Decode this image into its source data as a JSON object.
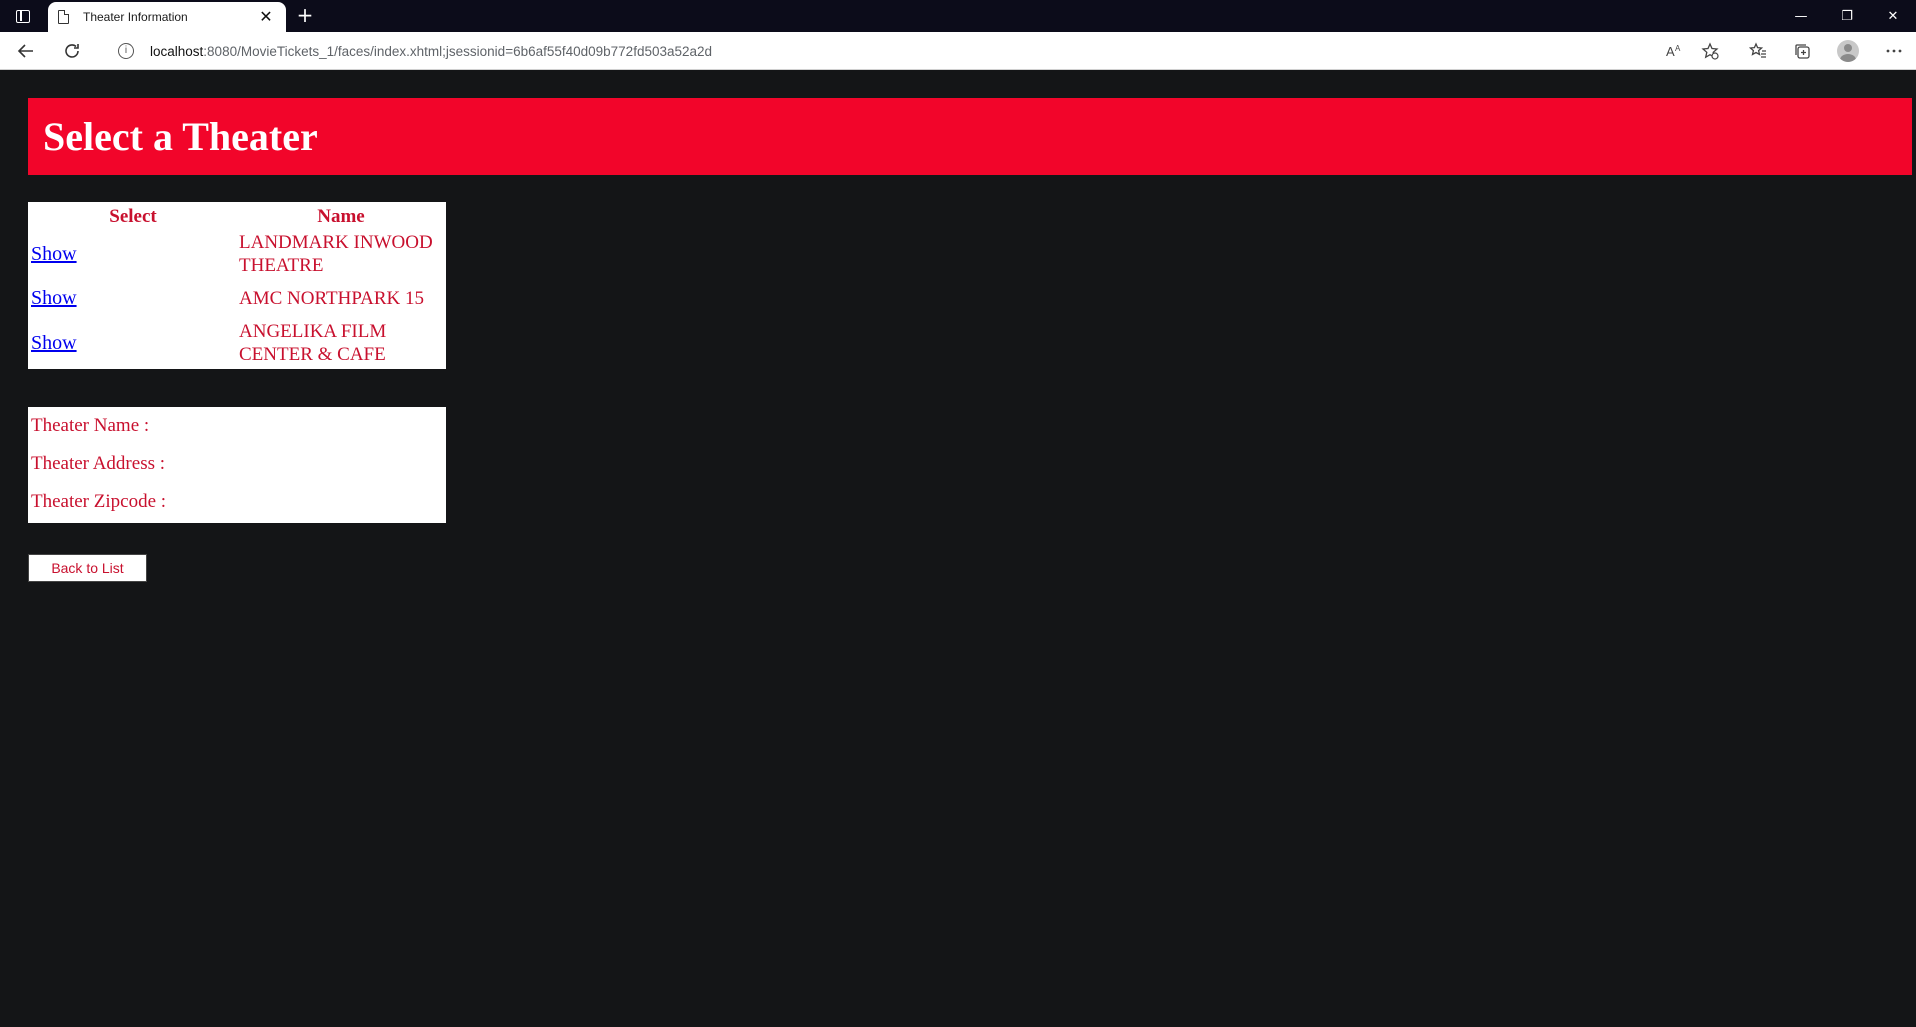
{
  "browser": {
    "tab_title": "Theater Information",
    "tab_close": "✕",
    "new_tab": "+",
    "url_host": "localhost",
    "url_rest": ":8080/MovieTickets_1/faces/index.xhtml;jsessionid=6b6af55f40d09b772fd503a52a2d",
    "controls": {
      "minimize": "—",
      "restore": "❐",
      "close": "✕"
    },
    "icons": [
      "back-icon",
      "refresh-icon",
      "info-icon",
      "read-aloud-icon",
      "add-favorite-icon",
      "favorites-icon",
      "collections-icon",
      "profile-icon",
      "more-icon"
    ]
  },
  "page": {
    "heading": "Select a Theater",
    "table": {
      "headers": {
        "select": "Select",
        "name": "Name"
      },
      "rows": [
        {
          "action": "Show",
          "name": "LANDMARK INWOOD THEATRE"
        },
        {
          "action": "Show",
          "name": "AMC NORTHPARK 15"
        },
        {
          "action": "Show",
          "name": "ANGELIKA FILM CENTER & CAFE"
        }
      ]
    },
    "details": {
      "name_label": "Theater Name :",
      "address_label": "Theater Address :",
      "zipcode_label": "Theater Zipcode :"
    },
    "back_button": "Back to List"
  },
  "colors": {
    "banner": "#f2052a",
    "text_accent": "#c8102e",
    "link": "#0000ee",
    "page_bg": "#141517"
  }
}
